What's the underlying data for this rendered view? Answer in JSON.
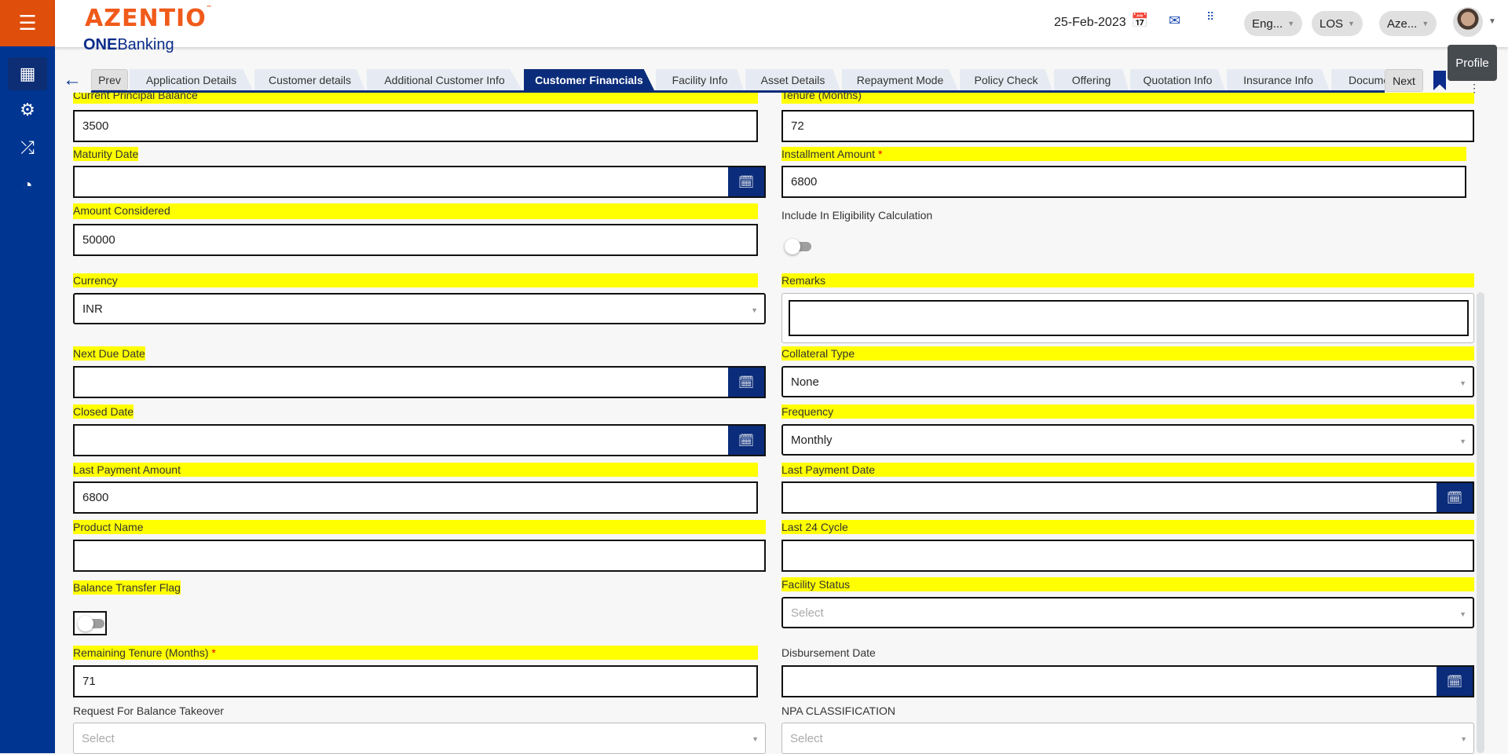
{
  "header": {
    "brand": "AZENTIO",
    "brand_tm": "™",
    "product_bold": "ONE",
    "product_rest": "Banking",
    "date": "25-Feb-2023",
    "language": "Eng...",
    "module": "LOS",
    "entity": "Aze...",
    "profile_tooltip": "Profile"
  },
  "tabs": {
    "prev": "Prev",
    "next": "Next",
    "items": [
      "Application Details",
      "Customer details",
      "Additional Customer Info",
      "Customer Financials",
      "Facility Info",
      "Asset Details",
      "Repayment Mode",
      "Policy Check",
      "Offering",
      "Quotation Info",
      "Insurance Info",
      "Docume"
    ],
    "active": "Customer Financials"
  },
  "form": {
    "current_principal_balance": {
      "label": "Current Principal Balance",
      "value": "3500"
    },
    "tenure": {
      "label": "Tenure (Months)",
      "value": "72"
    },
    "maturity_date": {
      "label": "Maturity Date",
      "value": ""
    },
    "installment_amount": {
      "label": "Installment Amount",
      "required": "*",
      "value": "6800"
    },
    "amount_considered": {
      "label": "Amount Considered",
      "value": "50000"
    },
    "include_eligibility": {
      "label": "Include In Eligibility Calculation",
      "on": false
    },
    "currency": {
      "label": "Currency",
      "value": "INR"
    },
    "remarks": {
      "label": "Remarks",
      "value": ""
    },
    "next_due_date": {
      "label": "Next Due Date",
      "value": ""
    },
    "collateral_type": {
      "label": "Collateral Type",
      "value": "None"
    },
    "closed_date": {
      "label": "Closed Date",
      "value": ""
    },
    "frequency": {
      "label": "Frequency",
      "value": "Monthly"
    },
    "last_payment_amount": {
      "label": "Last Payment Amount",
      "value": "6800"
    },
    "last_payment_date": {
      "label": "Last Payment Date",
      "value": ""
    },
    "product_name": {
      "label": "Product Name",
      "value": ""
    },
    "last_24_cycle": {
      "label": "Last 24 Cycle",
      "value": ""
    },
    "balance_transfer_flag": {
      "label": "Balance Transfer Flag",
      "on": false
    },
    "facility_status": {
      "label": "Facility Status",
      "placeholder": "Select"
    },
    "remaining_tenure": {
      "label": "Remaining Tenure (Months)",
      "required": "*",
      "value": "71"
    },
    "disbursement_date": {
      "label": "Disbursement Date",
      "value": ""
    },
    "request_balance_takeover": {
      "label": "Request For Balance Takeover",
      "placeholder": "Select"
    },
    "npa_classification": {
      "label": "NPA CLASSIFICATION",
      "placeholder": "Select"
    }
  }
}
